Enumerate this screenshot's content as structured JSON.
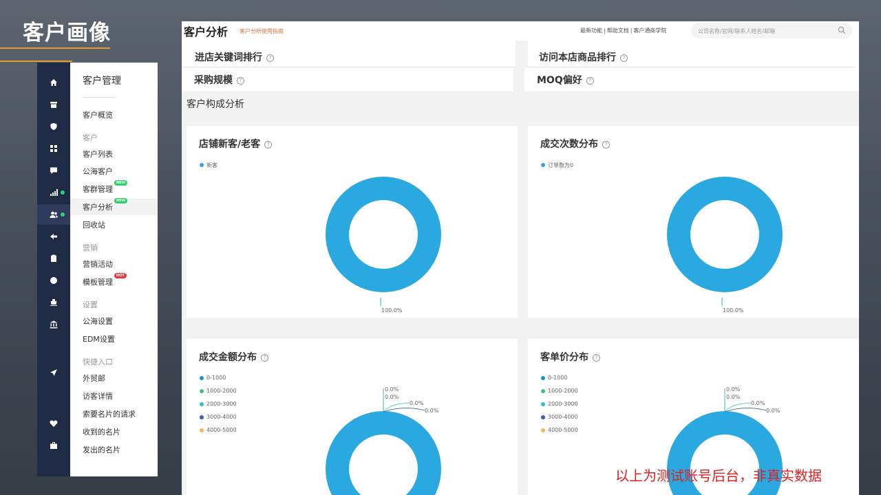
{
  "slide": {
    "title": "客户画像",
    "note": "以上为测试账号后台，非真实数据"
  },
  "rail": {
    "icons": [
      "home-icon",
      "store-icon",
      "shield-icon",
      "widgets-icon",
      "chat-icon",
      "chart-icon",
      "users-icon",
      "share-icon",
      "clipboard-icon",
      "globe-icon",
      "ship-icon",
      "bank-icon",
      "send-icon",
      "heart-icon",
      "bag-icon"
    ]
  },
  "subnav": {
    "title": "客户管理",
    "overview": "客户概览",
    "group_customer": "客户",
    "customer_list": "客户列表",
    "public_pool": "公海客户",
    "group_mgmt": "客群管理",
    "analysis": "客户分析",
    "recycle": "回收站",
    "group_marketing": "营销",
    "campaigns": "营销活动",
    "templates": "模板管理",
    "group_settings": "设置",
    "pool_settings": "公海设置",
    "edm_settings": "EDM设置",
    "group_shortcuts": "快捷入口",
    "trade_mail": "外贸邮",
    "visitor_detail": "访客详情",
    "card_requests": "索要名片的请求",
    "cards_received": "收到的名片",
    "cards_sent": "发出的名片",
    "badge_new": "NEW",
    "badge_hot": "HOT"
  },
  "header": {
    "title": "客户分析",
    "guide": "客户分析使用指南",
    "links": [
      "最新功能",
      "帮助文档",
      "客户通商学院"
    ],
    "search_placeholder": "公司名称/官网/联系人姓名/邮箱"
  },
  "sections": {
    "keywords": "进店关键词排行",
    "visited_products": "访问本店商品排行",
    "purchase_scale": "采购规模",
    "moq": "MOQ偏好",
    "composition": "客户构成分析",
    "help_glyph": "?"
  },
  "chart_data": [
    {
      "type": "pie",
      "title": "店铺新客/老客",
      "series": [
        {
          "name": "新客",
          "value": 100.0,
          "color": "#29a9e0"
        }
      ],
      "labels": [
        "100.0%"
      ]
    },
    {
      "type": "pie",
      "title": "成交次数分布",
      "series": [
        {
          "name": "订单数为0",
          "value": 100.0,
          "color": "#29a9e0"
        }
      ],
      "labels": [
        "100.0%"
      ]
    },
    {
      "type": "pie",
      "title": "成交金额分布",
      "series": [
        {
          "name": "0-1000",
          "value": 0.0,
          "color": "#1a8cd8"
        },
        {
          "name": "1000-2000",
          "value": 0.0,
          "color": "#3cc47c"
        },
        {
          "name": "2000-3000",
          "value": 0.0,
          "color": "#2ec4c4"
        },
        {
          "name": "3000-4000",
          "value": 0.0,
          "color": "#3561a8"
        },
        {
          "name": "4000-5000",
          "value": 0.0,
          "color": "#f5b35a"
        }
      ],
      "labels": [
        "0.0%",
        "0.0%",
        "0.0%",
        "0.0%"
      ]
    },
    {
      "type": "pie",
      "title": "客单价分布",
      "series": [
        {
          "name": "0-1000",
          "value": 0.0,
          "color": "#1a8cd8"
        },
        {
          "name": "1000-2000",
          "value": 0.0,
          "color": "#3cc47c"
        },
        {
          "name": "2000-3000",
          "value": 0.0,
          "color": "#2ec4c4"
        },
        {
          "name": "3000-4000",
          "value": 0.0,
          "color": "#3561a8"
        },
        {
          "name": "4000-5000",
          "value": 0.0,
          "color": "#f5b35a"
        }
      ],
      "labels": [
        "0.0%",
        "0.0%",
        "0.0%",
        "0.0%"
      ]
    }
  ],
  "colors": {
    "donut": "#29a9e0",
    "accent": "#e8713a",
    "rail_bg": "#1f2a45",
    "watermark": "#e02020"
  }
}
